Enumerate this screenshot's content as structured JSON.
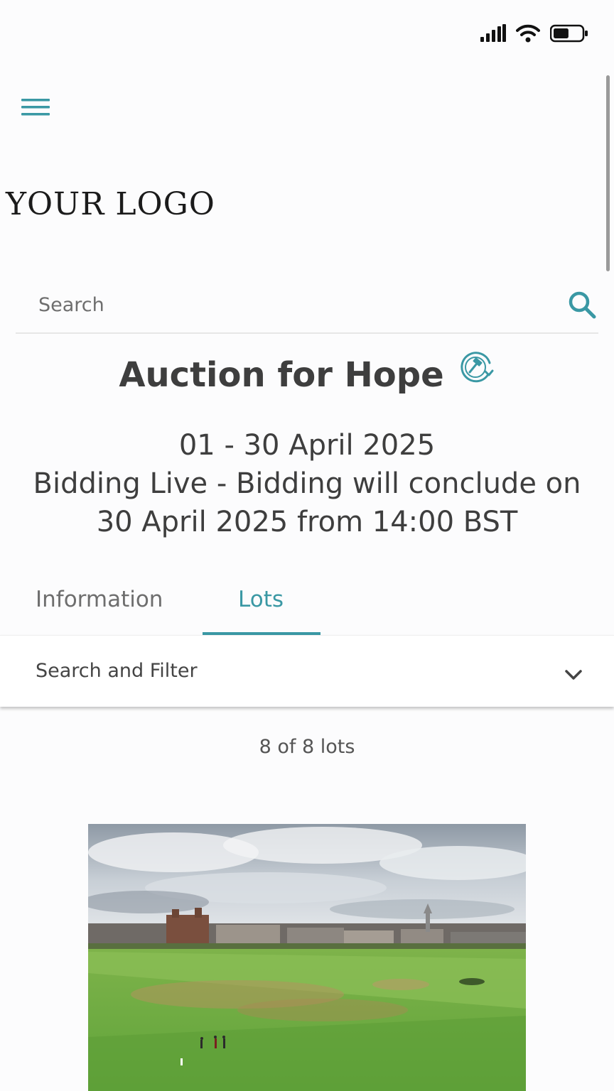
{
  "status_bar": {
    "cellular_icon": "signal-bars-icon",
    "wifi_icon": "wifi-icon",
    "battery_icon": "battery-icon",
    "battery_level": 0.55
  },
  "header": {
    "menu_icon": "hamburger-menu-icon",
    "logo_text": "YOUR LOGO"
  },
  "search": {
    "placeholder": "Search",
    "icon": "search-icon"
  },
  "auction": {
    "title": "Auction for Hope",
    "title_icon": "auction-gavel-refresh-icon",
    "dates": "01 - 30 April 2025",
    "status_line1": "Bidding Live - Bidding will conclude on",
    "status_line2": "30 April 2025 from 14:00 BST"
  },
  "tabs": [
    {
      "label": "Information",
      "active": false
    },
    {
      "label": "Lots",
      "active": true
    }
  ],
  "filter": {
    "label": "Search and Filter",
    "icon": "chevron-down-icon"
  },
  "lots": {
    "count_text": "8 of 8 lots"
  },
  "colors": {
    "accent": "#3a98a4",
    "text_dark": "#3e3e3e",
    "text_muted": "#6e6e6e"
  }
}
